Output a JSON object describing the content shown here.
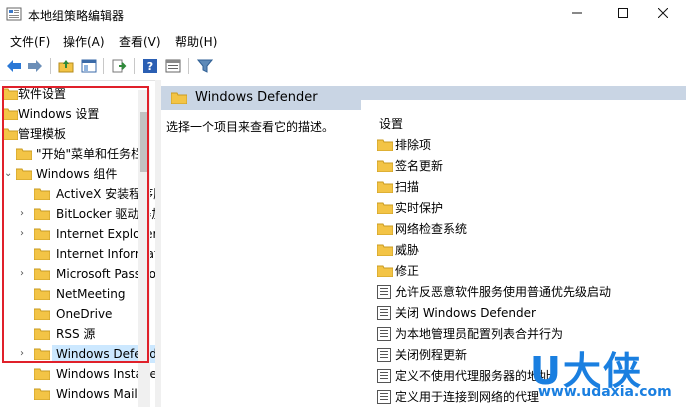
{
  "window": {
    "title": "本地组策略编辑器"
  },
  "menu": [
    "文件(F)",
    "操作(A)",
    "查看(V)",
    "帮助(H)"
  ],
  "toolbar": [
    "back-icon",
    "forward-icon",
    "up-folder-icon",
    "show-hide-tree-icon",
    "export-list-icon",
    "help-icon",
    "properties-icon",
    "filter-icon"
  ],
  "tree": [
    {
      "label": "软件设置"
    },
    {
      "label": "Windows 设置"
    },
    {
      "label": "管理模板"
    },
    {
      "label": "\"开始\"菜单和任务栏"
    },
    {
      "label": "Windows 组件"
    },
    {
      "label": "ActiveX 安装程序服务"
    },
    {
      "label": "BitLocker 驱动器加密"
    },
    {
      "label": "Internet Explorer"
    },
    {
      "label": "Internet Information Services"
    },
    {
      "label": "Microsoft Passport"
    },
    {
      "label": "NetMeeting"
    },
    {
      "label": "OneDrive"
    },
    {
      "label": "RSS 源"
    },
    {
      "label": "Windows Defender"
    },
    {
      "label": "Windows Installer"
    },
    {
      "label": "Windows Mail"
    }
  ],
  "right": {
    "header": "Windows Defender",
    "description": "选择一个项目来查看它的描述。",
    "column": "设置",
    "items": [
      {
        "label": "排除项",
        "type": "folder"
      },
      {
        "label": "签名更新",
        "type": "folder"
      },
      {
        "label": "扫描",
        "type": "folder"
      },
      {
        "label": "实时保护",
        "type": "folder"
      },
      {
        "label": "网络检查系统",
        "type": "folder"
      },
      {
        "label": "威胁",
        "type": "folder"
      },
      {
        "label": "修正",
        "type": "folder"
      },
      {
        "label": "允许反恶意软件服务使用普通优先级启动",
        "type": "setting"
      },
      {
        "label": "关闭 Windows Defender",
        "type": "setting"
      },
      {
        "label": "为本地管理员配置列表合并行为",
        "type": "setting"
      },
      {
        "label": "关闭例程更新",
        "type": "setting"
      },
      {
        "label": "定义不使用代理服务器的地址",
        "type": "setting"
      },
      {
        "label": "定义用于连接到网络的代理",
        "type": "setting"
      }
    ]
  },
  "watermark": {
    "main": "U大侠",
    "url": "www.udaxia.com"
  },
  "colors": {
    "selection": "#cce8ff",
    "header_bar": "#c9d5e4",
    "highlight_box": "#e0202a",
    "folder": "#f3c446",
    "watermark": "#1a7fe0"
  }
}
